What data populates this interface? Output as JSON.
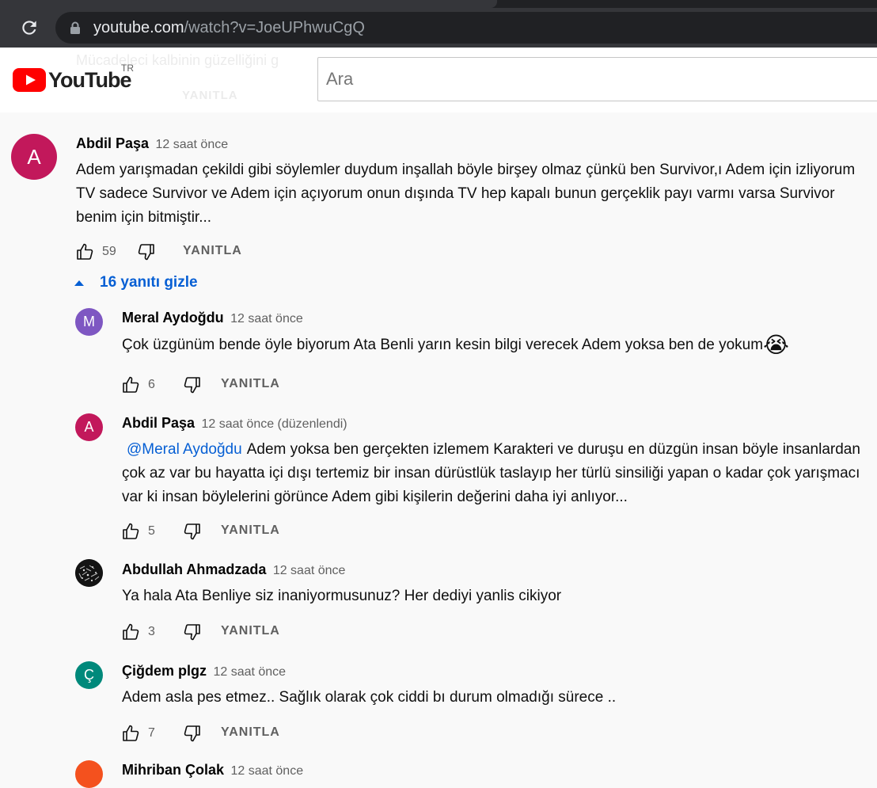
{
  "browser": {
    "url_host": "youtube.com",
    "url_path": "/watch?v=JoeUPhwuCgQ"
  },
  "masthead": {
    "logo_text": "YouTube",
    "country": "TR",
    "search_placeholder": "Ara",
    "ghost_comment_text": "Mücadeleci kalbinin güzelliğini g",
    "ghost_reply": "YANITLA"
  },
  "colors": {
    "brand_red": "#ff0000",
    "link_blue": "#065fd4",
    "avatar_crimson": "#c2185b",
    "avatar_purple": "#7e57c2",
    "avatar_teal": "#00897b",
    "avatar_orange": "#f4511e"
  },
  "top_comment": {
    "avatar_letter": "A",
    "author": "Abdil Paşa",
    "time": "12 saat önce",
    "text": "Adem yarışmadan çekildi gibi söylemler duydum inşallah böyle birşey olmaz çünkü ben Survivor,ı Adem için izliyorum TV sadece Survivor ve Adem için açıyorum onun dışında TV hep kapalı bunun gerçeklik payı varmı varsa Survivor benim için bitmiştir...",
    "likes": "59",
    "reply_label": "YANITLA"
  },
  "hide_replies_label": "16 yanıtı gizle",
  "replies": [
    {
      "avatar_letter": "M",
      "author": "Meral Aydoğdu",
      "time": "12 saat önce",
      "text": "Çok üzgünüm bende öyle biyorum Ata Benli yarın kesin bilgi verecek Adem yoksa ben de yokum",
      "emoji": "😭",
      "likes": "6",
      "reply_label": "YANITLA"
    },
    {
      "avatar_letter": "A",
      "author": "Abdil Paşa",
      "time": "12 saat önce (düzenlendi)",
      "mention": "@Meral Aydoğdu",
      "text": "Adem yoksa ben gerçekten izlemem Karakteri ve duruşu en düzgün insan böyle insanlardan çok az var bu hayatta içi dışı tertemiz bir insan dürüstlük taslayıp her türlü sinsiliği yapan o kadar çok yarışmacı var ki insan böylelerini görünce Adem gibi kişilerin değerini daha iyi anlıyor...",
      "likes": "5",
      "reply_label": "YANITLA"
    },
    {
      "author": "Abdullah Ahmadzada",
      "time": "12 saat önce",
      "text": "Ya hala Ata Benliye siz inaniyormusunuz? Her dediyi yanlis cikiyor",
      "likes": "3",
      "reply_label": "YANITLA"
    },
    {
      "avatar_letter": "Ç",
      "author": "Çiğdem plgz",
      "time": "12 saat önce",
      "text": "Adem asla pes etmez.. Sağlık olarak çok ciddi bı durum olmadığı sürece ..",
      "likes": "7",
      "reply_label": "YANITLA"
    },
    {
      "author": "Mihriban Çolak",
      "time": "12 saat önce"
    }
  ]
}
